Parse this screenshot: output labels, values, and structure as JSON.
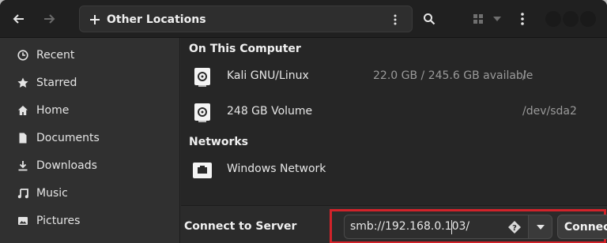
{
  "header": {
    "location_title": "Other Locations"
  },
  "sidebar": {
    "items": [
      {
        "label": "Recent",
        "icon": "clock-icon"
      },
      {
        "label": "Starred",
        "icon": "star-icon"
      },
      {
        "label": "Home",
        "icon": "home-icon"
      },
      {
        "label": "Documents",
        "icon": "document-icon"
      },
      {
        "label": "Downloads",
        "icon": "download-icon"
      },
      {
        "label": "Music",
        "icon": "music-icon"
      },
      {
        "label": "Pictures",
        "icon": "picture-icon"
      }
    ]
  },
  "main": {
    "on_this_computer": "On This Computer",
    "devices": [
      {
        "name": "Kali GNU/Linux",
        "size": "22.0 GB / 245.6 GB available",
        "path": "/"
      },
      {
        "name": "248 GB Volume",
        "size": "",
        "path": "/dev/sda2"
      }
    ],
    "networks": "Networks",
    "network_items": [
      {
        "name": "Windows Network"
      }
    ]
  },
  "bottom": {
    "connect_label": "Connect to Server",
    "server_value": "smb://192.168.0.103/",
    "connect_button": "Connect"
  },
  "colors": {
    "highlight": "#d2232a",
    "window_bg": "#2b2b2b",
    "sidebar_bg": "#303030"
  }
}
